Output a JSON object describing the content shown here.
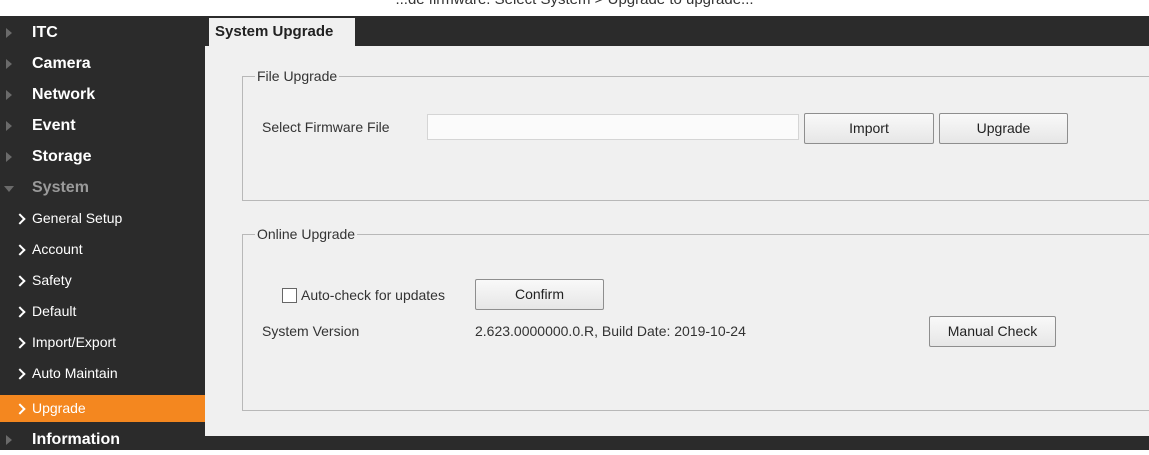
{
  "caption": "...de firmware. Select System > Upgrade to upgrade...",
  "sidebar": {
    "items": [
      {
        "label": "ITC"
      },
      {
        "label": "Camera"
      },
      {
        "label": "Network"
      },
      {
        "label": "Event"
      },
      {
        "label": "Storage"
      },
      {
        "label": "System"
      }
    ],
    "sub_items": [
      {
        "label": "General Setup"
      },
      {
        "label": "Account"
      },
      {
        "label": "Safety"
      },
      {
        "label": "Default"
      },
      {
        "label": "Import/Export"
      },
      {
        "label": "Auto Maintain"
      },
      {
        "label": "Upgrade"
      }
    ],
    "last_item": {
      "label": "Information"
    },
    "active_color": "#f4871f"
  },
  "tab": {
    "label": "System Upgrade"
  },
  "file_upgrade": {
    "legend": "File Upgrade",
    "select_label": "Select Firmware File",
    "file_value": "",
    "import_label": "Import",
    "upgrade_label": "Upgrade"
  },
  "online_upgrade": {
    "legend": "Online Upgrade",
    "auto_check_label": "Auto-check for updates",
    "auto_check_checked": false,
    "confirm_label": "Confirm",
    "version_label": "System Version",
    "version_value": "2.623.0000000.0.R, Build Date: 2019-10-24",
    "manual_check_label": "Manual Check"
  }
}
